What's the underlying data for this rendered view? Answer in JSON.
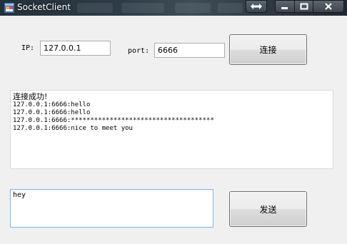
{
  "window": {
    "title": "SocketClient"
  },
  "connection": {
    "ip_label": "IP:",
    "ip_value": "127.0.0.1",
    "port_label": "port:",
    "port_value": "6666",
    "connect_button": "连接"
  },
  "log": {
    "lines": [
      "连接成功!",
      "127.0.0.1:6666:hello",
      "127.0.0.1:6666:hello",
      "127.0.0.1:6666:*************************************",
      "127.0.0.1:6666:nice to meet you"
    ]
  },
  "compose": {
    "message_value": "hey",
    "send_button": "发送"
  },
  "colors": {
    "window_bg": "#f0f0f0",
    "focus_border": "#7eb4ea"
  }
}
